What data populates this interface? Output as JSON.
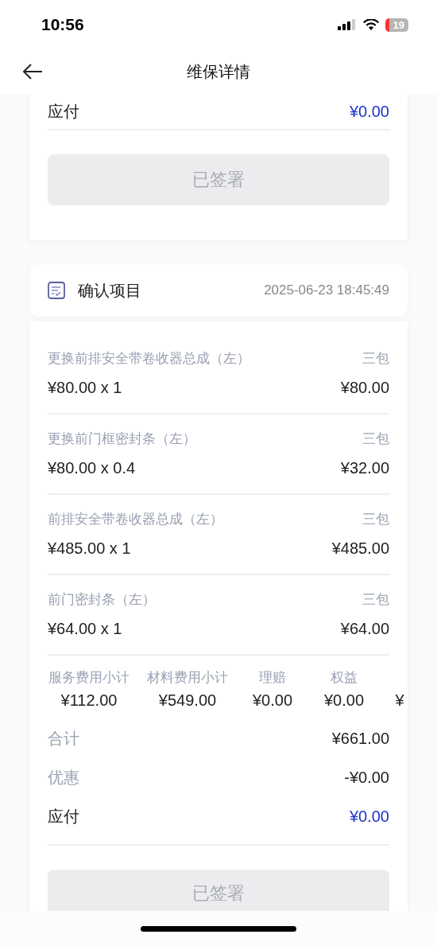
{
  "status_bar": {
    "time": "10:56",
    "battery": "19"
  },
  "nav": {
    "title": "维保详情"
  },
  "top_card": {
    "payable_label": "应付",
    "payable_value": "¥0.00",
    "button": {
      "label": "已签署",
      "disabled": true
    }
  },
  "confirm_header": {
    "title": "确认项目",
    "time": "2025-06-23 18:45:49"
  },
  "items": [
    {
      "name": "更换前排安全带卷收器总成（左）",
      "tag": "三包",
      "price": "¥80.00 x 1",
      "amount": "¥80.00"
    },
    {
      "name": "更换前门框密封条（左）",
      "tag": "三包",
      "price": "¥80.00 x 0.4",
      "amount": "¥32.00"
    },
    {
      "name": "前排安全带卷收器总成（左）",
      "tag": "三包",
      "price": "¥485.00 x 1",
      "amount": "¥485.00"
    },
    {
      "name": "前门密封条（左）",
      "tag": "三包",
      "price": "¥64.00 x 1",
      "amount": "¥64.00"
    }
  ],
  "subtotals": [
    {
      "label": "服务费用小计",
      "value": "¥112.00"
    },
    {
      "label": "材料费用小计",
      "value": "¥549.00"
    },
    {
      "label": "理赔",
      "value": "¥0.00"
    },
    {
      "label": "权益",
      "value": "¥0.00"
    },
    {
      "value": "¥"
    }
  ],
  "totals": [
    {
      "kind": "muted",
      "label": "合计",
      "value": "¥661.00"
    },
    {
      "kind": "muted",
      "label": "优惠",
      "value": "-¥0.00"
    },
    {
      "kind": "payable",
      "label": "应付",
      "value": "¥0.00"
    }
  ],
  "bottom_button": {
    "label": "已签署",
    "disabled": true
  }
}
